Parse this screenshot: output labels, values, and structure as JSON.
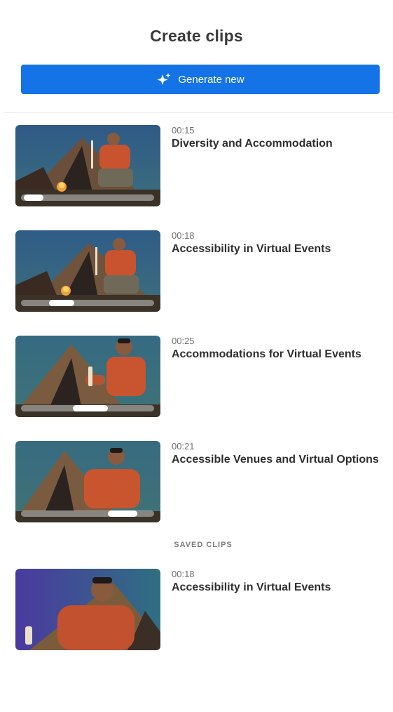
{
  "header": {
    "title": "Create clips"
  },
  "generate_button": {
    "label": "Generate new",
    "icon": "sparkle-icon",
    "color": "#1473e6"
  },
  "clips": [
    {
      "duration": "00:15",
      "title": "Diversity and Accommodation",
      "scrub_position": 0.1
    },
    {
      "duration": "00:18",
      "title": "Accessibility in Virtual Events",
      "scrub_position": 0.3
    },
    {
      "duration": "00:25",
      "title": "Accommodations for Virtual Events",
      "scrub_position": 0.6
    },
    {
      "duration": "00:21",
      "title": "Accessible Venues and Virtual Options",
      "scrub_position": 0.9
    }
  ],
  "saved_section": {
    "label": "SAVED CLIPS",
    "clips": [
      {
        "duration": "00:18",
        "title": "Accessibility in Virtual Events"
      }
    ]
  }
}
